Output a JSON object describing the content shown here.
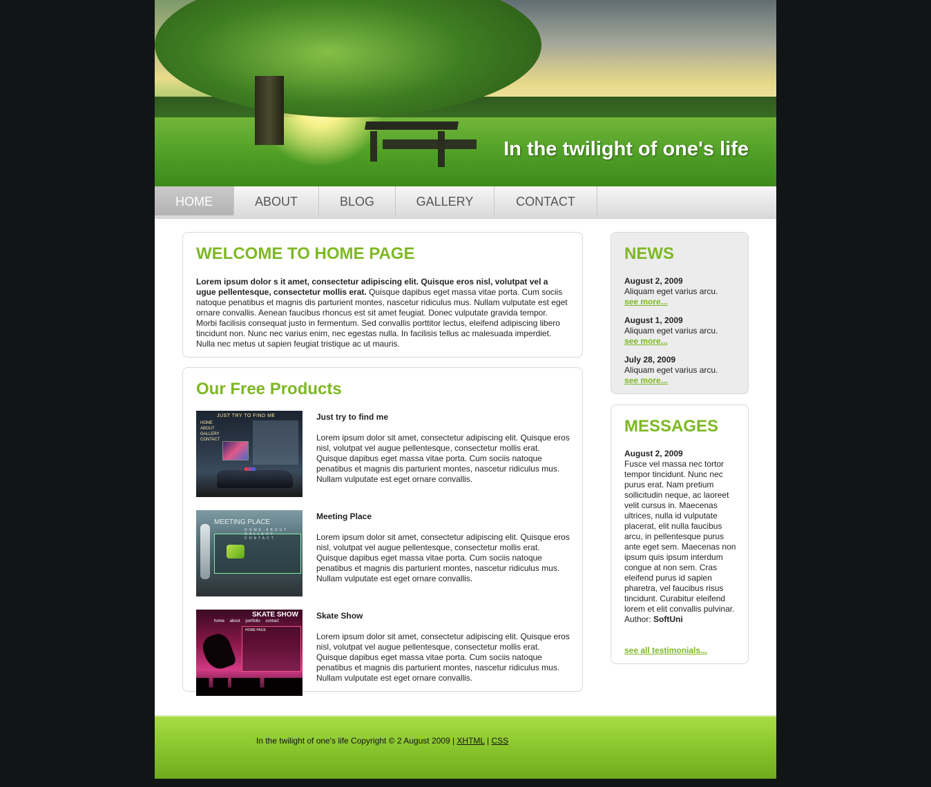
{
  "site": {
    "title": "In the twilight of one's life"
  },
  "nav": {
    "items": [
      {
        "label": "HOME",
        "active": true
      },
      {
        "label": "ABOUT",
        "active": false
      },
      {
        "label": "BLOG",
        "active": false
      },
      {
        "label": "GALLERY",
        "active": false
      },
      {
        "label": "CONTACT",
        "active": false
      }
    ]
  },
  "welcome": {
    "heading": "WELCOME TO HOME PAGE",
    "lead": "Lorem ipsum dolor s it amet, consectetur adipiscing elit. Quisque eros nisl, volutpat vel a ugue pellentesque, consectetur mollis erat.",
    "body": " Quisque dapibus eget massa vitae porta. Cum sociis natoque penatibus et magnis dis parturient montes, nascetur ridiculus mus. Nullam vulputate est eget ornare convallis. Aenean faucibus rhoncus est sit amet feugiat. Donec vulputate gravida tempor. Morbi facilisis consequat justo in fermentum. Sed convallis porttitor lectus, eleifend adipiscing libero tincidunt non. Nunc nec varius enim, nec egestas nulla. In facilisis tellus ac malesuada imperdiet. Nulla nec metus ut sapien feugiat tristique ac ut mauris."
  },
  "products": {
    "heading": "Our Free Products",
    "items": [
      {
        "title": "Just try to find me",
        "desc": "Lorem ipsum dolor sit amet, consectetur adipiscing elit. Quisque eros nisl, volutpat vel augue pellentesque, consectetur mollis erat. Quisque dapibus eget massa vitae porta. Cum sociis natoque penatibus et magnis dis parturient montes, nascetur ridiculus mus. Nullam vulputate est eget ornare convallis.",
        "thumb": {
          "header": "JUST TRY TO FIND ME",
          "menu": "HOME ABOUT GALLERY CONTACT"
        }
      },
      {
        "title": "Meeting Place",
        "desc": "Lorem ipsum dolor sit amet, consectetur adipiscing elit. Quisque eros nisl, volutpat vel augue pellentesque, consectetur mollis erat. Quisque dapibus eget massa vitae porta. Cum sociis natoque penatibus et magnis dis parturient montes, nascetur ridiculus mus. Nullam vulputate est eget ornare convallis.",
        "thumb": {
          "header": "MEETING PLACE",
          "menu": "HOME ABOUT GALLERY CONTACT"
        }
      },
      {
        "title": "Skate Show",
        "desc": "Lorem ipsum dolor sit amet, consectetur adipiscing elit. Quisque eros nisl, volutpat vel augue pellentesque, consectetur mollis erat. Quisque dapibus eget massa vitae porta. Cum sociis natoque penatibus et magnis dis parturient montes, nascetur ridiculus mus. Nullam vulputate est eget ornare convallis.",
        "thumb": {
          "header": "SKATE SHOW",
          "menu": "home about portfolio contact",
          "panel": "HOME PAGE"
        }
      }
    ]
  },
  "news": {
    "heading": "NEWS",
    "items": [
      {
        "date": "August 2, 2009",
        "text": "Aliquam eget varius arcu.",
        "link": "see more..."
      },
      {
        "date": "August 1, 2009",
        "text": "Aliquam eget varius arcu.",
        "link": "see more..."
      },
      {
        "date": "July 28, 2009",
        "text": "Aliquam eget varius arcu.",
        "link": "see more..."
      }
    ]
  },
  "messages": {
    "heading": "MESSAGES",
    "date": "August 2, 2009",
    "text": "Fusce vel massa nec tortor tempor tincidunt. Nunc nec purus erat. Nam pretium sollicitudin neque, ac laoreet velit cursus in. Maecenas ultrices, nulla id vulputate placerat, elit nulla faucibus arcu, in pellentesque purus ante eget sem. Maecenas non ipsum quis ipsum interdum congue at non sem. Cras eleifend purus id sapien pharetra, vel faucibus risus tincidunt. Curabitur eleifend lorem et elit convallis pulvinar.",
    "author_label": "Author:",
    "author": "SoftUni",
    "all_link": "see all testimonials..."
  },
  "footer": {
    "text": "In the twilight of one's life Copyright © 2 August 2009 | ",
    "link1": "XHTML",
    "sep": " | ",
    "link2": "CSS"
  },
  "colors": {
    "accent": "#7db824",
    "page_bg": "#111516",
    "footer": "#8cc82f"
  }
}
